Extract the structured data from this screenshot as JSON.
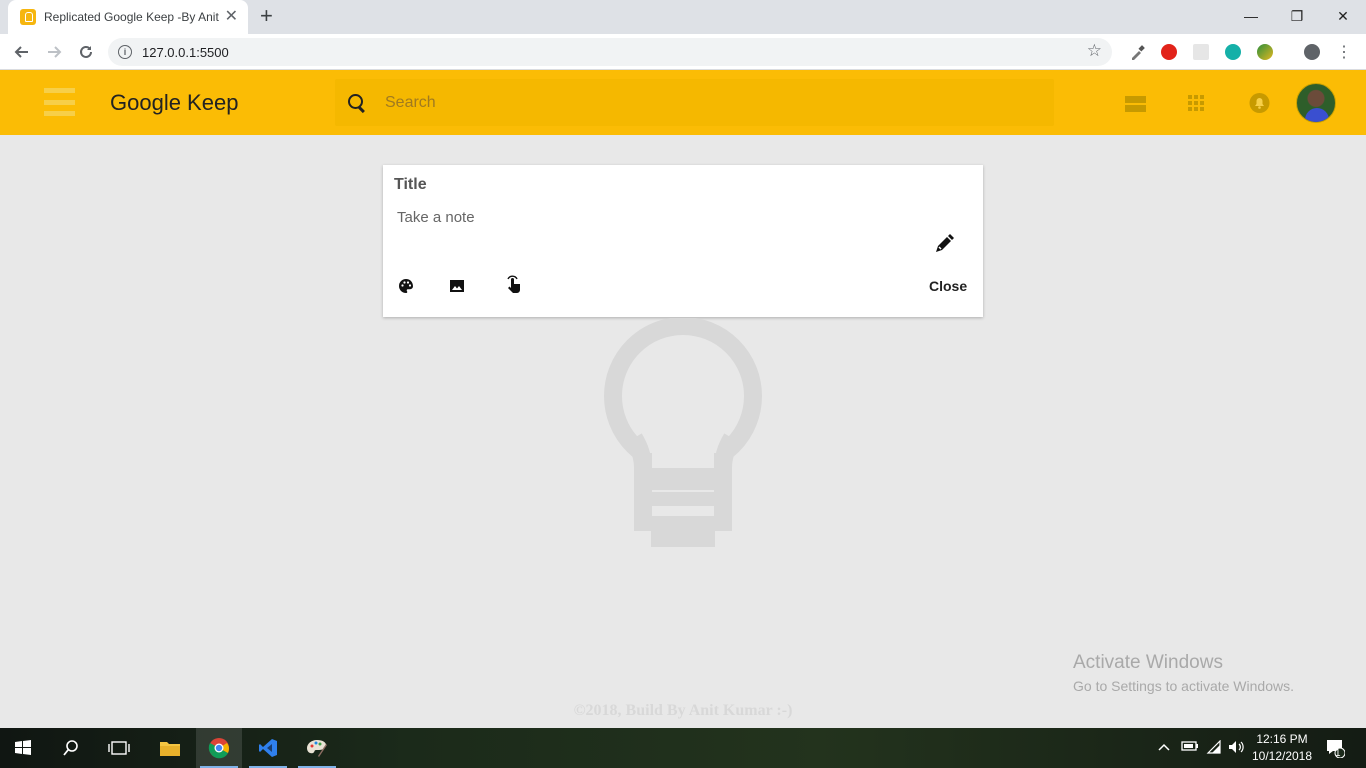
{
  "browser": {
    "tab_title": "Replicated Google Keep -By Anit Kumar",
    "tab_close": "✕",
    "new_tab": "+",
    "url": "127.0.0.1:5500",
    "window_controls": {
      "minimize": "—",
      "restore": "❐",
      "close": "✕"
    }
  },
  "app": {
    "brand": "Google Keep",
    "search_placeholder": "Search",
    "accent_color": "#fbbc05"
  },
  "note": {
    "title_placeholder": "Title",
    "body_placeholder": "Take a note",
    "close_label": "Close",
    "tools": [
      "palette-icon",
      "image-icon",
      "touch-icon"
    ]
  },
  "footer": {
    "text": "©2018, Build By Anit Kumar :-)"
  },
  "watermark": {
    "line1": "Activate Windows",
    "line2": "Go to Settings to activate Windows."
  },
  "taskbar": {
    "time": "12:16 PM",
    "date": "10/12/2018",
    "notification_count": "1"
  }
}
